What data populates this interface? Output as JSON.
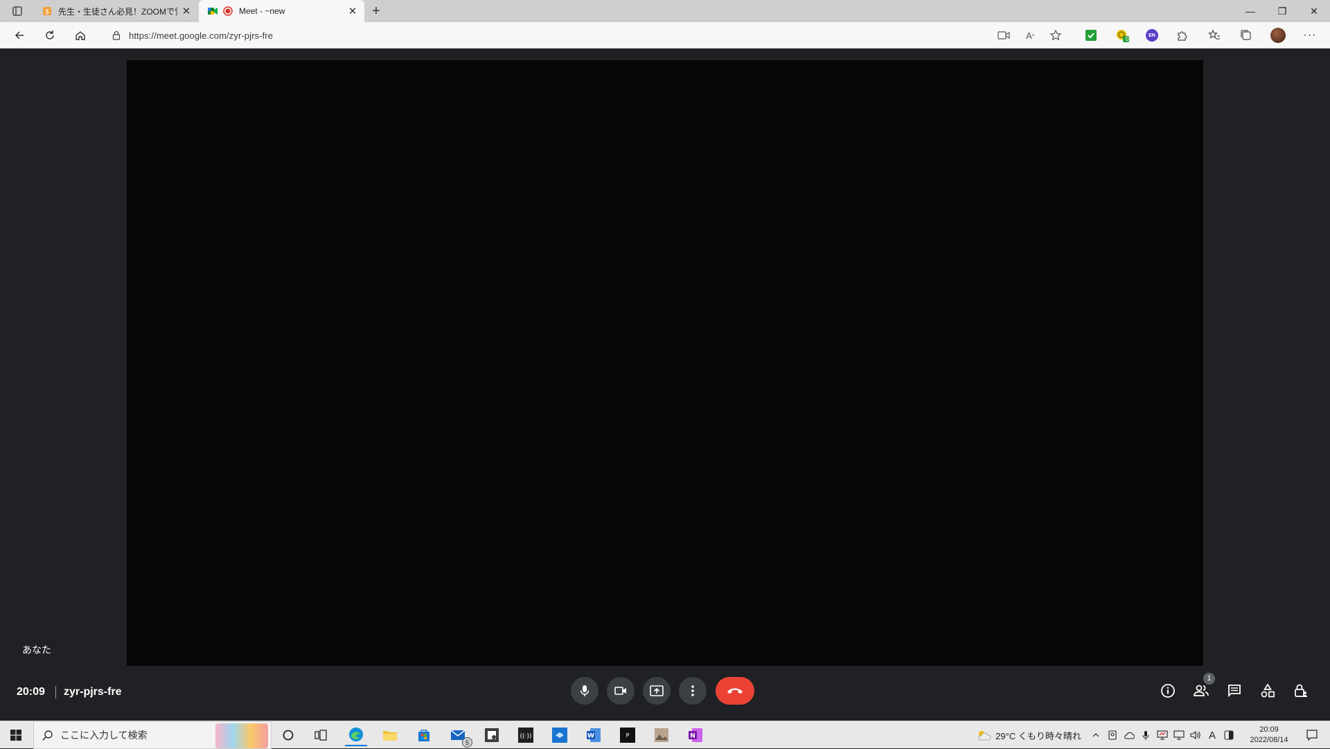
{
  "browser": {
    "tabs": [
      {
        "title": "先生・生徒さん必見！ZOOMで雪",
        "favicon": "page-icon",
        "active": false
      },
      {
        "title": "Meet - ~new",
        "favicon": "meet-recording-icon",
        "active": true
      }
    ],
    "new_tab_label": "+",
    "window_controls": {
      "minimize": "—",
      "restore": "❐",
      "close": "✕"
    },
    "address_url": "https://meet.google.com/zyr-pjrs-fre",
    "extension_badges": {
      "coin": "0",
      "lang": "EN"
    }
  },
  "meet": {
    "self_label": "あなた",
    "time": "20:09",
    "meeting_code": "zyr-pjrs-fre",
    "participant_count": "1",
    "colors": {
      "bg": "#202124",
      "button": "#3c4043",
      "hangup": "#ea4335"
    }
  },
  "taskbar": {
    "search_placeholder": "ここに入力して検索",
    "mail_badge": "5",
    "weather": "29°C くもり時々晴れ",
    "ime": "A",
    "clock_time": "20:09",
    "clock_date": "2022/08/14"
  }
}
